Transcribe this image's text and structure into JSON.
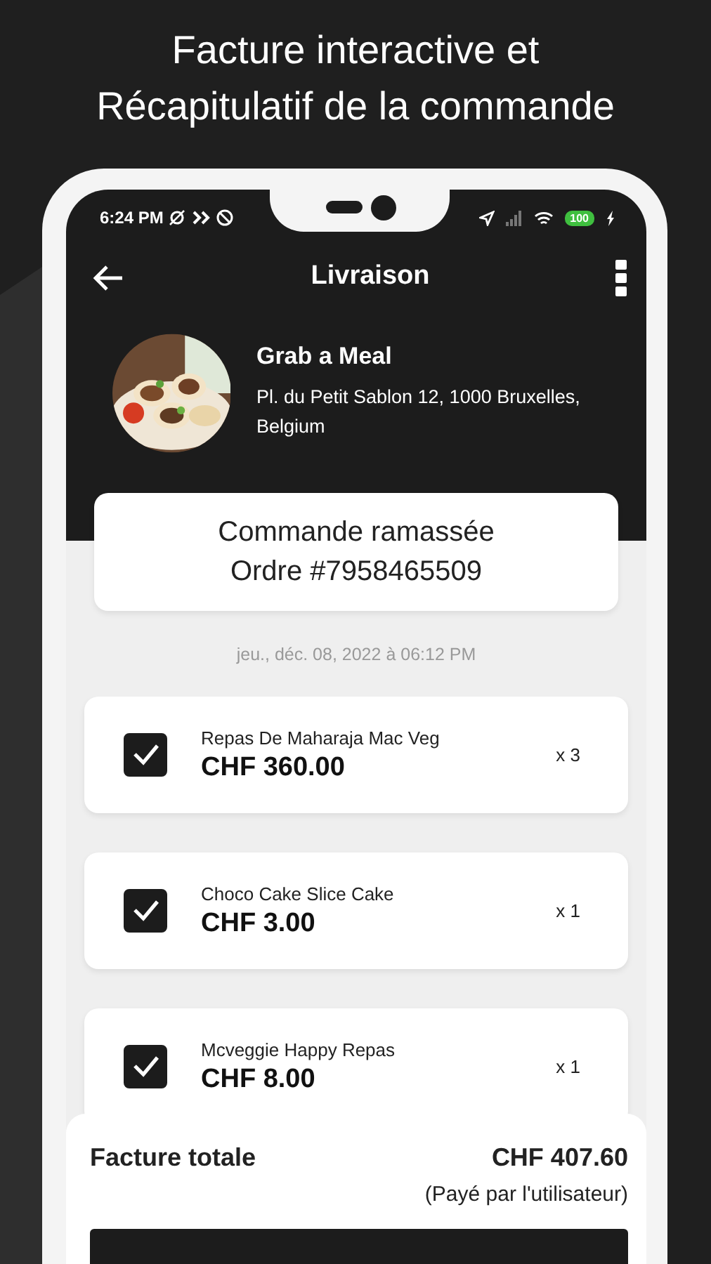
{
  "headline": [
    "Facture interactive et",
    "Récapitulatif de la commande"
  ],
  "status_bar": {
    "time": "6:24 PM",
    "battery": "100"
  },
  "app_bar": {
    "title": "Livraison"
  },
  "restaurant": {
    "name": "Grab a Meal",
    "address": "Pl. du Petit Sablon 12, 1000 Bruxelles, Belgium"
  },
  "order": {
    "status": "Commande ramassée",
    "number": "Ordre #7958465509"
  },
  "date": "jeu., déc. 08, 2022 à 06:12 PM",
  "items": [
    {
      "name": "Repas De Maharaja Mac Veg",
      "price": "CHF 360.00",
      "quantity": "x 3",
      "checked": true
    },
    {
      "name": "Choco Cake Slice Cake",
      "price": "CHF 3.00",
      "quantity": "x 1",
      "checked": true
    },
    {
      "name": "Mcveggie Happy Repas",
      "price": "CHF 8.00",
      "quantity": "x 1",
      "checked": true
    }
  ],
  "total": {
    "label": "Facture totale",
    "amount": "CHF 407.60",
    "note": "(Payé par l'utilisateur)"
  }
}
